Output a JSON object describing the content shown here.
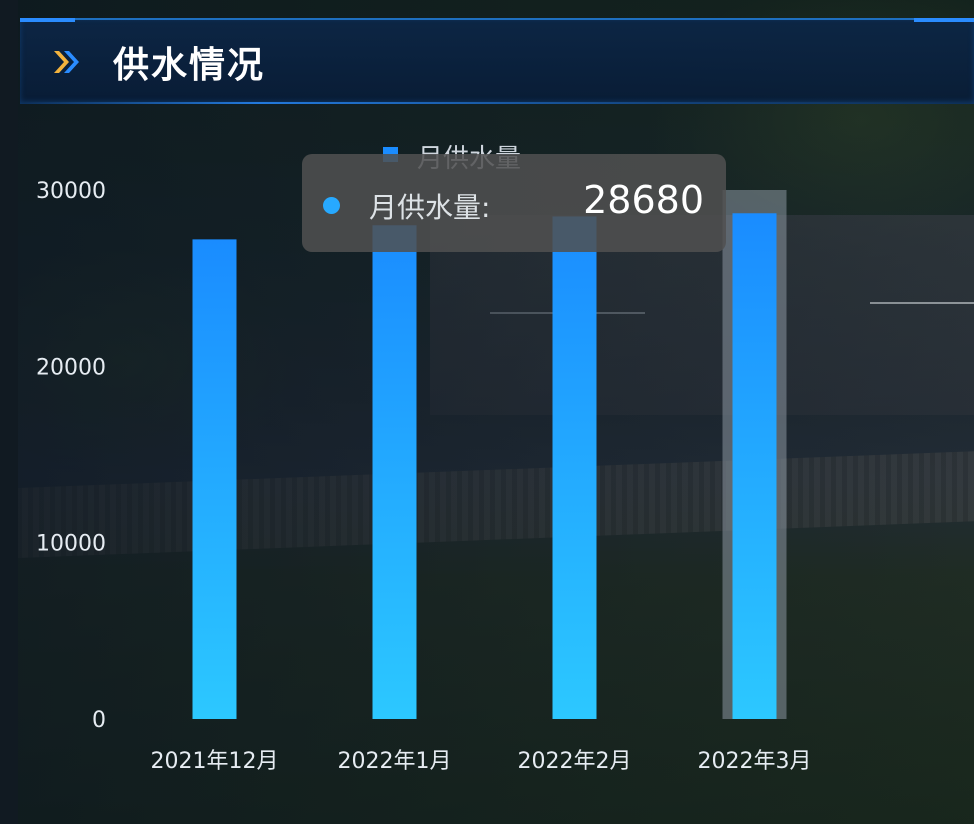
{
  "panel": {
    "title": "供水情况"
  },
  "tooltip": {
    "label": "月供水量:",
    "value": "28680"
  },
  "colors": {
    "bar_top": "#1a8cff",
    "bar_bottom": "#2cc8ff",
    "highlight": "#8a96a0",
    "tooltip_dot": "#27a9ff",
    "header_accent": "#2a8cff"
  },
  "chart_data": {
    "type": "bar",
    "categories": [
      "2021年12月",
      "2022年1月",
      "2022年2月",
      "2022年3月"
    ],
    "series": [
      {
        "name": "月供水量",
        "values": [
          27200,
          28000,
          28500,
          28680
        ]
      }
    ],
    "ylim": [
      0,
      30000
    ],
    "yticks": [
      "0",
      "10000",
      "20000",
      "30000"
    ],
    "grid": false,
    "legend": "top-center",
    "highlighted_category": "2022年3月"
  }
}
